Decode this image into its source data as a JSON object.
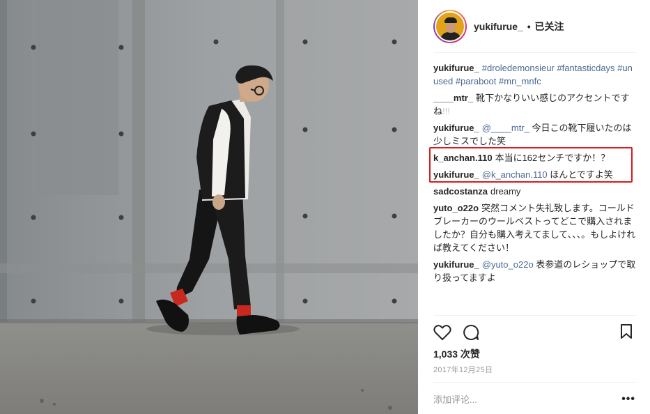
{
  "header": {
    "username": "yukifurue_",
    "separator": "•",
    "follow_status": "已关注"
  },
  "comments": [
    {
      "user": "yukifurue_",
      "parts": [
        {
          "t": "tag",
          "v": "#droledemonsieur"
        },
        {
          "t": "text",
          "v": " "
        },
        {
          "t": "tag",
          "v": "#fantasticdays"
        },
        {
          "t": "text",
          "v": " "
        },
        {
          "t": "tag",
          "v": "#unused"
        },
        {
          "t": "text",
          "v": " "
        },
        {
          "t": "tag",
          "v": "#paraboot"
        },
        {
          "t": "text",
          "v": " "
        },
        {
          "t": "tag",
          "v": "#mn_mnfc"
        }
      ]
    },
    {
      "user": "____mtr_",
      "parts": [
        {
          "t": "text",
          "v": "靴下かなりいい感じのアクセントですね"
        },
        {
          "t": "ghost",
          "v": "!!!"
        }
      ]
    },
    {
      "user": "yukifurue_",
      "parts": [
        {
          "t": "mention",
          "v": "@____mtr_"
        },
        {
          "t": "text",
          "v": " 今日この靴下履いたのは少しミスでした笑"
        }
      ]
    },
    {
      "user": "k_anchan.110",
      "parts": [
        {
          "t": "text",
          "v": "本当に162センチですか！？"
        }
      ]
    },
    {
      "user": "yukifurue_",
      "parts": [
        {
          "t": "mention",
          "v": "@k_anchan.110"
        },
        {
          "t": "text",
          "v": " ほんとですよ笑"
        }
      ]
    },
    {
      "user": "sadcostanza",
      "parts": [
        {
          "t": "text",
          "v": "dreamy"
        }
      ]
    },
    {
      "user": "yuto_o22o",
      "parts": [
        {
          "t": "text",
          "v": "突然コメント失礼致します。コールドブレーカーのウールベストってどこで購入されましたか？自分も購入考えてまして、、、。もしよければ教えてください！"
        }
      ]
    },
    {
      "user": "yukifurue_",
      "parts": [
        {
          "t": "mention",
          "v": "@yuto_o22o"
        },
        {
          "t": "text",
          "v": " 表参道のレショップで取り扱ってますよ"
        }
      ]
    }
  ],
  "actions": {
    "like_icon": "heart-icon",
    "comment_icon": "comment-icon",
    "save_icon": "bookmark-icon"
  },
  "likes": "1,033 次赞",
  "date": "2017年12月25日",
  "add_comment": {
    "placeholder": "添加评论..."
  },
  "more_label": "•••",
  "colors": {
    "highlight_box": "#d91c1c",
    "hashtag": "#4a6a92",
    "socks": "#c8281e"
  }
}
